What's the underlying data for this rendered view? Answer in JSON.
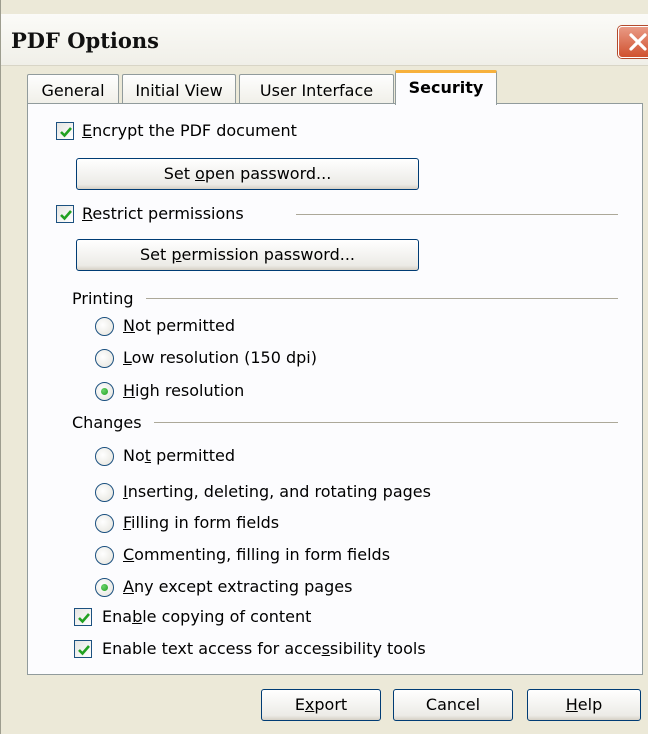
{
  "dialog": {
    "title": "PDF Options"
  },
  "tabs": [
    {
      "label": "General"
    },
    {
      "label": "Initial View"
    },
    {
      "label": "User Interface"
    },
    {
      "label": "Security",
      "active": true
    }
  ],
  "security": {
    "encrypt": {
      "pre": "",
      "u": "E",
      "post": "ncrypt the PDF document",
      "checked": true
    },
    "set_open_password": {
      "pre": "Set ",
      "u": "o",
      "post": "pen password..."
    },
    "restrict": {
      "pre": "",
      "u": "R",
      "post": "estrict permissions",
      "checked": true
    },
    "set_permission_password": {
      "pre": "Set ",
      "u": "p",
      "post": "ermission password..."
    },
    "printing": {
      "heading": "Printing",
      "options": [
        {
          "pre": "",
          "u": "N",
          "post": "ot permitted",
          "selected": false
        },
        {
          "pre": "",
          "u": "L",
          "post": "ow resolution (150 dpi)",
          "selected": false
        },
        {
          "pre": "",
          "u": "H",
          "post": "igh resolution",
          "selected": true
        }
      ]
    },
    "changes": {
      "heading": "Changes",
      "options": [
        {
          "pre": "No",
          "u": "t",
          "post": " permitted",
          "selected": false
        },
        {
          "pre": "",
          "u": "I",
          "post": "nserting, deleting, and rotating pages",
          "selected": false
        },
        {
          "pre": "",
          "u": "F",
          "post": "illing in form fields",
          "selected": false
        },
        {
          "pre": "",
          "u": "C",
          "post": "ommenting, filling in form fields",
          "selected": false
        },
        {
          "pre": "",
          "u": "A",
          "post": "ny except extracting pages",
          "selected": true
        }
      ]
    },
    "enable_copying": {
      "pre": "Ena",
      "u": "b",
      "post": "le copying of content",
      "checked": true
    },
    "enable_text_access": {
      "pre": "Enable text access for acce",
      "u": "s",
      "post": "sibility tools",
      "checked": true
    }
  },
  "buttons": {
    "export": {
      "pre": "E",
      "u": "x",
      "post": "port"
    },
    "cancel": {
      "pre": "Cancel",
      "u": "",
      "post": ""
    },
    "help": {
      "pre": "",
      "u": "H",
      "post": "elp"
    }
  },
  "colors": {
    "accent_tab": "#f7b13c",
    "close_button": "#d0512f",
    "check_mark": "#21a121"
  },
  "icons": {
    "close": "close-icon",
    "check": "checkmark-icon",
    "radio_dot": "radio-dot-icon"
  }
}
